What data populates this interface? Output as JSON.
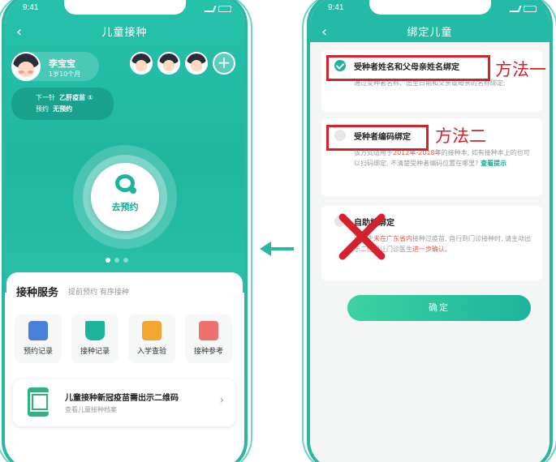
{
  "status_time": "9:41",
  "left": {
    "nav_title": "儿童接种",
    "back_icon": "‹",
    "child": {
      "name": "李宝宝",
      "age": "1岁10个月"
    },
    "next": {
      "label": "下一针",
      "vaccine": "乙肝疫苗 ①",
      "appt_label": "预约",
      "appt_value": "无预约"
    },
    "cta_label": "去预约",
    "services": {
      "title": "接种服务",
      "subtitle": "提前预约 有序接种",
      "items": [
        {
          "label": "预约记录",
          "icon": "calendar-icon",
          "color": "#4a7fd8"
        },
        {
          "label": "接种记录",
          "icon": "open-book-icon",
          "color": "#1cb49d"
        },
        {
          "label": "入学查验",
          "icon": "certificate-icon",
          "color": "#f2a730"
        },
        {
          "label": "接种参考",
          "icon": "reference-book-icon",
          "color": "#ef6f6f"
        }
      ]
    },
    "qr": {
      "title": "儿童接种新冠疫苗需出示二维码",
      "subtitle": "查看儿童接种档案"
    }
  },
  "right": {
    "nav_title": "绑定儿童",
    "options": [
      {
        "title": "受种者姓名和父母亲姓名绑定",
        "desc": "通过受种者名称、出生日期和父亲或母亲的名称绑定;",
        "checked": true
      },
      {
        "title": "受种者编码绑定",
        "desc_parts": [
          "该方式适用于",
          "2012年-2018年",
          "的接种本, 如有接种本上的也可以扫码绑定, 不清楚受种者编码位置在哪里?",
          " 查看提示"
        ],
        "checked": false
      },
      {
        "title": "自助档绑定",
        "desc_parts": [
          "适用于",
          "未在广东省内",
          "接种过疫苗, 自行到门诊接种时, 请主动出示二维码让门诊医生",
          "进一步确认",
          "。"
        ],
        "checked": false
      }
    ],
    "confirm_label": "确定"
  },
  "annotations": {
    "method1": "方法一",
    "method2": "方法二",
    "color": "#d6202c"
  },
  "colors": {
    "brand": "#1cb49d",
    "highlight": "#e8553c"
  }
}
